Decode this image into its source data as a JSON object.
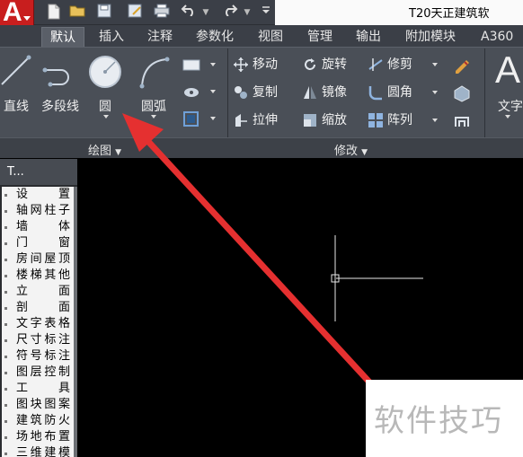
{
  "app": {
    "title": "T20天正建筑软"
  },
  "tabs": [
    {
      "label": "默认"
    },
    {
      "label": "插入"
    },
    {
      "label": "注释"
    },
    {
      "label": "参数化"
    },
    {
      "label": "视图"
    },
    {
      "label": "管理"
    },
    {
      "label": "输出"
    },
    {
      "label": "附加模块"
    },
    {
      "label": "A360"
    }
  ],
  "draw_panel": {
    "line": "直线",
    "polyline": "多段线",
    "circle": "圆",
    "arc": "圆弧",
    "footer": "绘图"
  },
  "modify_panel": {
    "move": "移动",
    "rotate": "旋转",
    "trim": "修剪",
    "copy": "复制",
    "mirror": "镜像",
    "fillet": "圆角",
    "stretch": "拉伸",
    "scale": "缩放",
    "array": "阵列",
    "footer": "修改"
  },
  "text_panel": {
    "big_letter": "A",
    "text": "文字"
  },
  "sidebar": {
    "header": "T...",
    "items": [
      "设　置",
      "轴网柱子",
      "墙　体",
      "门　窗",
      "房间屋顶",
      "楼梯其他",
      "立　面",
      "剖　面",
      "文字表格",
      "尺寸标注",
      "符号标注",
      "图层控制",
      "工　具",
      "图块图案",
      "建筑防火",
      "场地布置",
      "三维建模"
    ]
  },
  "watermark": {
    "text": "软件技巧"
  },
  "colors": {
    "logo": "#c81e1e",
    "arrow": "#e53030",
    "ribbon": "#4a4f57",
    "canvas": "#000000"
  }
}
